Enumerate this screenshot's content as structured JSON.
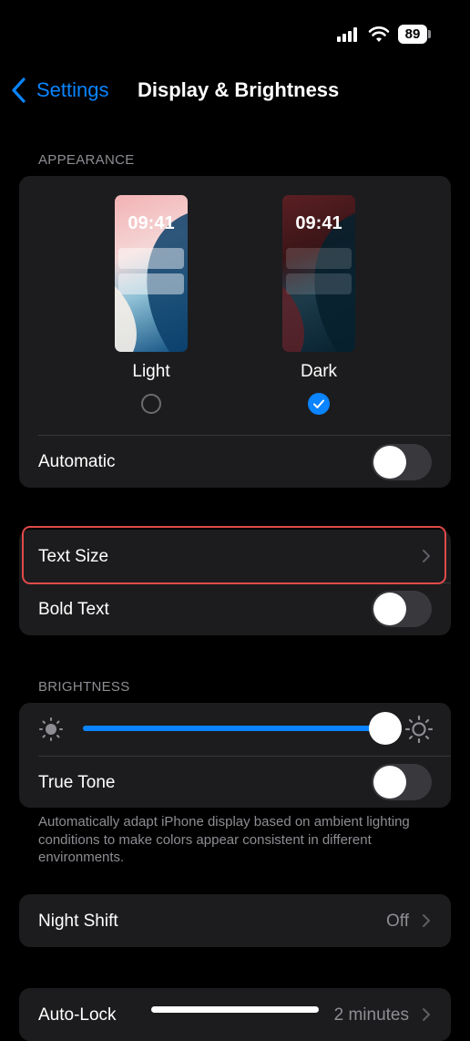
{
  "status_bar": {
    "battery": "89"
  },
  "nav": {
    "back_label": "Settings",
    "title": "Display & Brightness"
  },
  "appearance": {
    "section_label": "APPEARANCE",
    "light": {
      "time": "09:41",
      "label": "Light",
      "selected": false
    },
    "dark": {
      "time": "09:41",
      "label": "Dark",
      "selected": true
    },
    "automatic": {
      "label": "Automatic",
      "on": false
    }
  },
  "text": {
    "text_size_label": "Text Size",
    "bold_text": {
      "label": "Bold Text",
      "on": false
    }
  },
  "brightness": {
    "section_label": "BRIGHTNESS",
    "level": 1.0,
    "true_tone": {
      "label": "True Tone",
      "on": false
    },
    "footnote": "Automatically adapt iPhone display based on ambient lighting conditions to make colors appear consistent in different environments."
  },
  "night_shift": {
    "label": "Night Shift",
    "value": "Off"
  },
  "auto_lock": {
    "label": "Auto-Lock",
    "value": "2 minutes"
  },
  "colors": {
    "accent": "#0a84ff",
    "highlight": "#e04a4a",
    "card": "#1c1c1e"
  }
}
